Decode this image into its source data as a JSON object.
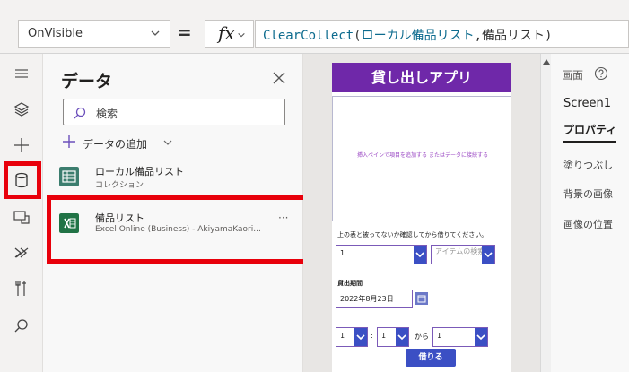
{
  "formula_bar": {
    "property": "OnVisible",
    "equals": "=",
    "fx_label": "fx",
    "formula": {
      "function": "ClearCollect",
      "open": "(",
      "collection": "ローカル備品リスト",
      "comma": ",",
      "source": "備品リスト",
      "close": ")"
    }
  },
  "rail": {
    "icons": [
      "hamburger-icon",
      "layers-icon",
      "plus-icon",
      "database-icon",
      "media-icon",
      "advanced-tools-icon",
      "tools-icon",
      "search-icon"
    ],
    "active": "database-icon"
  },
  "data_panel": {
    "title": "データ",
    "search_placeholder": "検索",
    "add_data": "データの追加",
    "items": [
      {
        "name": "ローカル備品リスト",
        "sub": "コレクション",
        "icon": "collection-icon",
        "color": "#3b7d6e"
      },
      {
        "name": "備品リスト",
        "sub": "Excel Online (Business) - AkiyamaKaori...",
        "icon": "excel-icon",
        "color": "#217346",
        "more": "···"
      }
    ],
    "highlight_color": "#e8000b"
  },
  "app": {
    "header": "貸し出しアプリ",
    "header_color": "#6f28a9",
    "gallery_placeholder": "挿入ペインで項目を追加する またはデータに接続する",
    "note": "上の表と被ってないか確認してから借りてください。",
    "quantity_value": "1",
    "item_placeholder": "アイテムの検索",
    "period_label": "貸出期間",
    "date_value": "2022年8月23日",
    "hour_value": "1",
    "minute_value": "1",
    "colon": ":",
    "from_label": "から",
    "to_value": "1",
    "borrow_button": "借りる",
    "button_color": "#3b4fc4"
  },
  "properties": {
    "header": "画面",
    "screen_name": "Screen1",
    "tab": "プロパティ",
    "rows": [
      "塗りつぶし",
      "背景の画像",
      "画像の位置"
    ]
  }
}
